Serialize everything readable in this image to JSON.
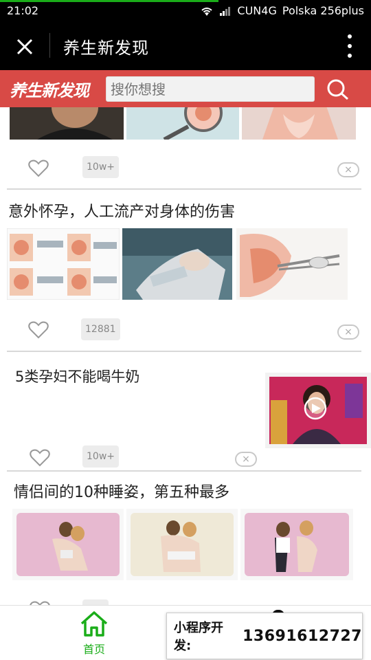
{
  "status_bar": {
    "time": "21:02",
    "network": "CUN4G",
    "carrier": "Polska 256plus"
  },
  "title_bar": {
    "title": "养生新发现",
    "close_icon": "close-icon",
    "more_icon": "more-vertical-icon"
  },
  "search_header": {
    "logo_text": "养生新发现",
    "search_placeholder": "搜你想搜",
    "search_icon": "search-icon",
    "color": "#d84a46"
  },
  "feed": {
    "articles": [
      {
        "title": "",
        "count": "10w+",
        "dismiss": "×",
        "thumbnails": [
          "man-portrait",
          "magnifier-organ",
          "woman-torso"
        ]
      },
      {
        "title": "意外怀孕，人工流产对身体的伤害",
        "count": "12881",
        "dismiss": "×",
        "thumbnails": [
          "medical-diagram",
          "surgical-procedure",
          "anatomy-illustration"
        ]
      },
      {
        "title": "5类孕妇不能喝牛奶",
        "count": "10w+",
        "dismiss": "×",
        "thumbnails": [
          "video-thumbnail"
        ],
        "video_icon": "play-icon"
      },
      {
        "title": "情侣间的10种睡姿，第五种最多",
        "thumbnails": [
          "couple-sleeping-1",
          "couple-sleeping-2",
          "couple-sleeping-3"
        ]
      }
    ]
  },
  "bottom_nav": {
    "home_label": "首页",
    "home_icon": "home-icon",
    "accent": "#1aad19"
  },
  "ad": {
    "label": "小程序开发:",
    "phone": "13691612727"
  }
}
